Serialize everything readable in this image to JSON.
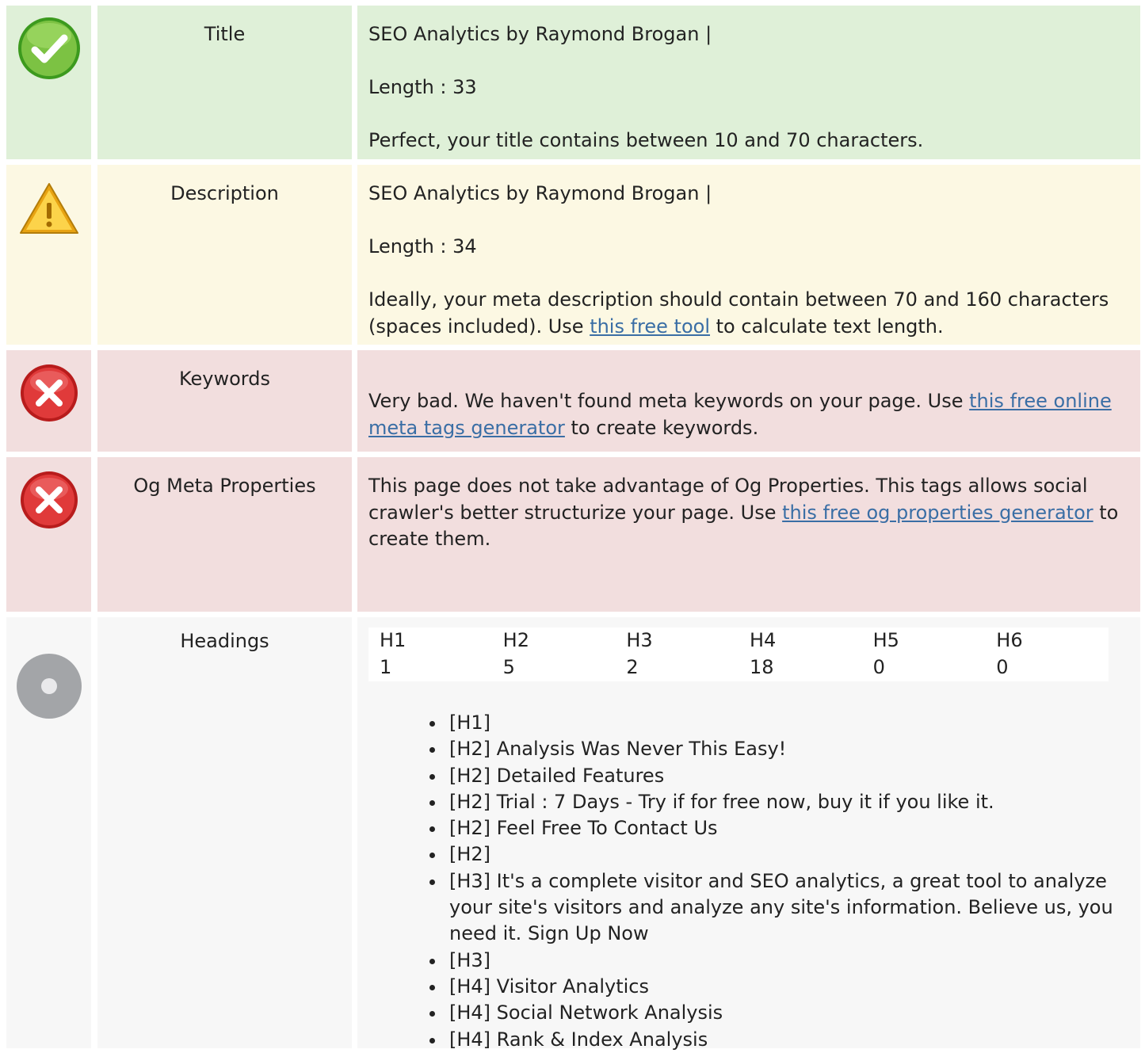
{
  "colors": {
    "good_bg": "#dff0d8",
    "warn_bg": "#fcf8e3",
    "bad_bg": "#f2dede",
    "neutral_bg": "#f7f7f7",
    "link": "#3a6ea5"
  },
  "rows": {
    "title": {
      "status_icon": "check-circle-icon",
      "label": "Title",
      "value": "SEO Analytics by Raymond Brogan |",
      "length": "Length : 33",
      "message": "Perfect, your title contains between 10 and 70 characters."
    },
    "description": {
      "status_icon": "warning-triangle-icon",
      "label": "Description",
      "value": "SEO Analytics by Raymond Brogan |",
      "length": "Length : 34",
      "message_before": "Ideally, your meta description should contain between 70 and 160 characters (spaces included). Use ",
      "link": "this free tool",
      "message_after": " to calculate text length."
    },
    "keywords": {
      "status_icon": "error-x-circle-icon",
      "label": "Keywords",
      "message_before": "Very bad. We haven't found meta keywords on your page. Use ",
      "link": "this free online meta tags generator",
      "message_after": " to create keywords."
    },
    "og": {
      "status_icon": "error-x-circle-icon",
      "label": "Og Meta Properties",
      "message_before": "This page does not take advantage of Og Properties. This tags allows social crawler's better structurize your page. Use ",
      "link": "this free og properties generator",
      "message_after": " to create them."
    },
    "headings": {
      "status_icon": "info-circle-icon",
      "label": "Headings",
      "table_headers": [
        "H1",
        "H2",
        "H3",
        "H4",
        "H5",
        "H6"
      ],
      "table_counts": [
        "1",
        "5",
        "2",
        "18",
        "0",
        "0"
      ],
      "items": [
        "[H1]",
        "[H2] Analysis Was Never This Easy!",
        "[H2] Detailed Features",
        "[H2] Trial : 7 Days - Try if for free now, buy it if you like it.",
        "[H2] Feel Free To Contact Us",
        "[H2]",
        "[H3] It's a complete visitor and SEO analytics, a great tool to analyze your site's visitors and analyze any site's information. Believe us, you need it. Sign Up Now",
        "[H3]",
        "[H4] Visitor Analytics",
        "[H4] Social Network Analysis",
        "[H4] Rank & Index Analysis"
      ]
    }
  }
}
